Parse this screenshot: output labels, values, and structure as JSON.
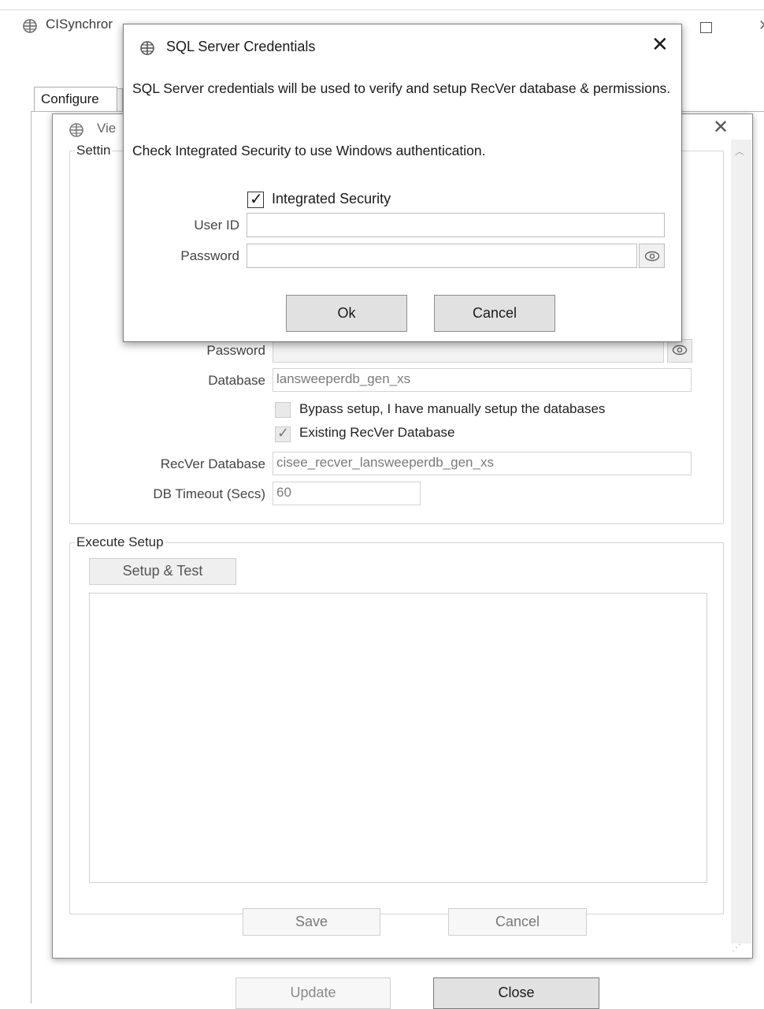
{
  "main_window": {
    "title": "CISynchror",
    "tab_configure": "Configure",
    "update_label": "Update",
    "close_label": "Close"
  },
  "view_dialog": {
    "title": "Vie",
    "settings_legend": "Settin",
    "password_label": "Password",
    "database_label": "Database",
    "database_value": "lansweeperdb_gen_xs",
    "bypass_label": "Bypass setup, I have manually setup the databases",
    "bypass_checked": false,
    "existing_label": "Existing RecVer Database",
    "existing_checked": true,
    "recver_label": "RecVer Database",
    "recver_value": "cisee_recver_lansweeperdb_gen_xs",
    "timeout_label": "DB Timeout (Secs)",
    "timeout_value": "60",
    "execute_legend": "Execute Setup",
    "setup_test_label": "Setup & Test",
    "save_label": "Save",
    "cancel_label": "Cancel"
  },
  "sql_dialog": {
    "title": "SQL Server Credentials",
    "description_line1": "SQL Server credentials will be used to verify and setup RecVer database & permissions.",
    "description_line2": "Check Integrated Security to use Windows authentication.",
    "integrated_security_label": "Integrated Security",
    "integrated_security_checked": true,
    "userid_label": "User ID",
    "userid_value": "",
    "password_label": "Password",
    "password_value": "",
    "ok_label": "Ok",
    "cancel_label": "Cancel"
  },
  "icons": {
    "app": "app-globe-icon",
    "close": "close-icon",
    "maximize": "maximize-icon",
    "eye": "eye-icon",
    "scroll_up": "chevron-up-icon",
    "resize_grip": "resize-grip-icon"
  }
}
